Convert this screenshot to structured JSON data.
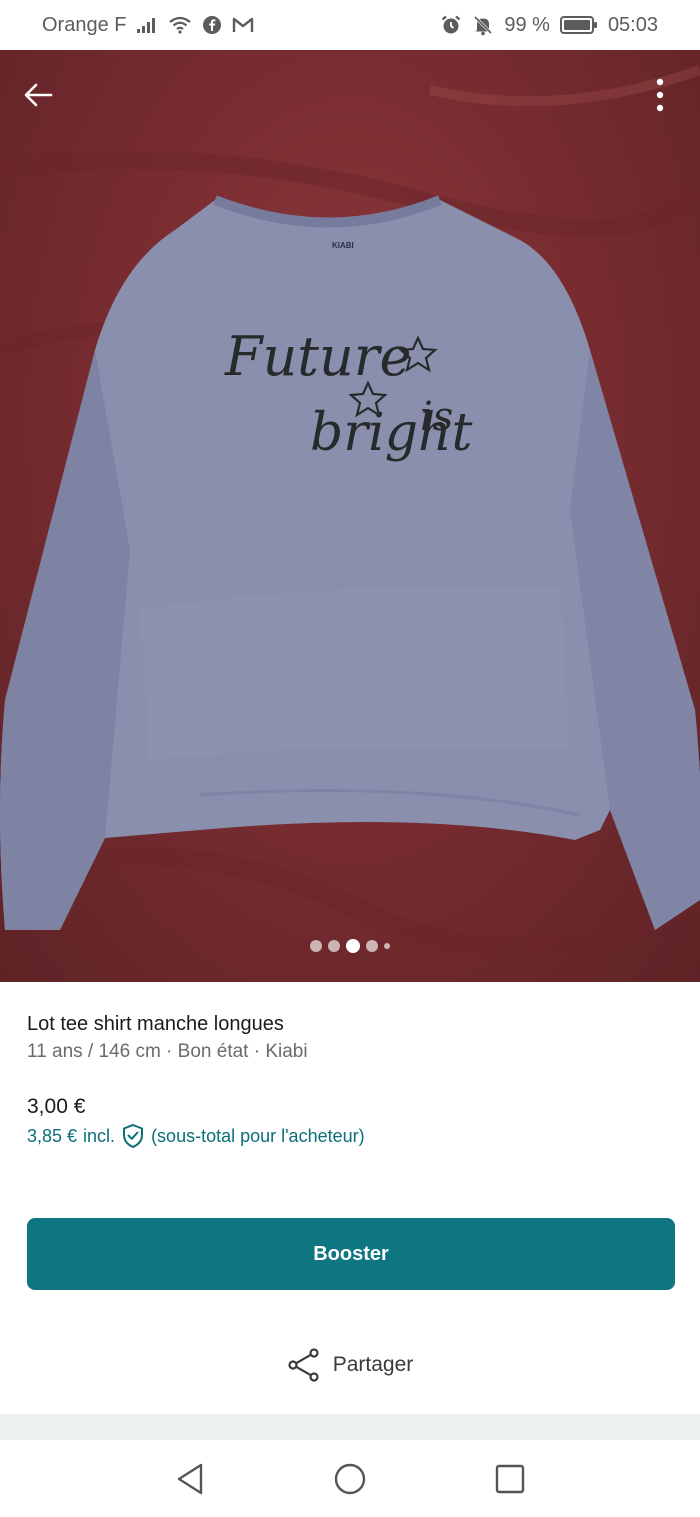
{
  "status_bar": {
    "carrier": "Orange F",
    "battery": "99 %",
    "time": "05:03",
    "icons": [
      "signal-icon",
      "wifi-icon",
      "facebook-icon",
      "gmail-icon",
      "alarm-icon",
      "mute-icon",
      "battery-icon"
    ]
  },
  "photo": {
    "print_text_1": "Future",
    "print_text_2": "is",
    "print_text_3": "bright",
    "label": "KIABI",
    "pager": {
      "count": 5,
      "active_index": 2
    }
  },
  "listing": {
    "title": "Lot tee shirt manche longues",
    "meta": "11 ans / 146 cm · Bon état · Kiabi",
    "price": "3,00 €",
    "price_incl_amount": "3,85 €",
    "price_incl_word": "incl.",
    "price_incl_note": "(sous-total pour l'acheteur)"
  },
  "actions": {
    "boost_label": "Booster",
    "share_label": "Partager"
  },
  "colors": {
    "accent": "#0d7680",
    "accent_text": "#0b6e78"
  }
}
